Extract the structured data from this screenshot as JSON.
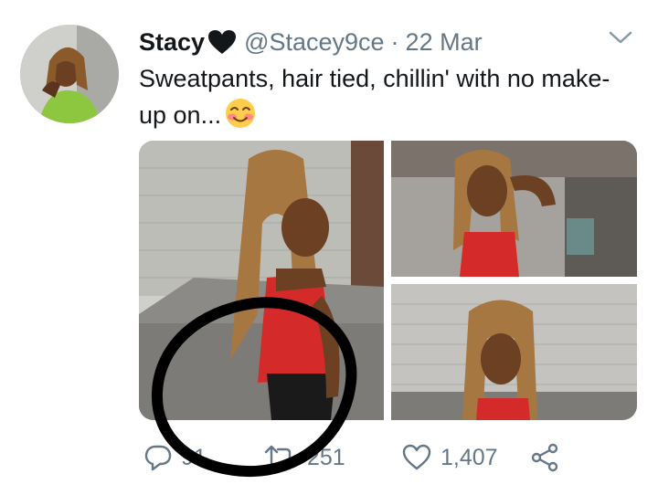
{
  "tweet": {
    "name": "Stacy",
    "handle": "@Stacey9ce",
    "separator": "·",
    "date": "22 Mar",
    "text": "Sweatpants, hair tied, chillin' with no make-up on...",
    "actions": {
      "reply_count": "91",
      "retweet_count": "251",
      "like_count": "1,407"
    }
  },
  "icons": {
    "heart": "black-heart-icon",
    "chevron": "chevron-down-icon",
    "emoji": "smiling-face-emoji",
    "reply": "reply-icon",
    "retweet": "retweet-icon",
    "like": "like-icon",
    "share": "share-icon"
  },
  "colors": {
    "text": "#14171a",
    "secondary": "#657786",
    "red_top": "#d42a2a"
  }
}
